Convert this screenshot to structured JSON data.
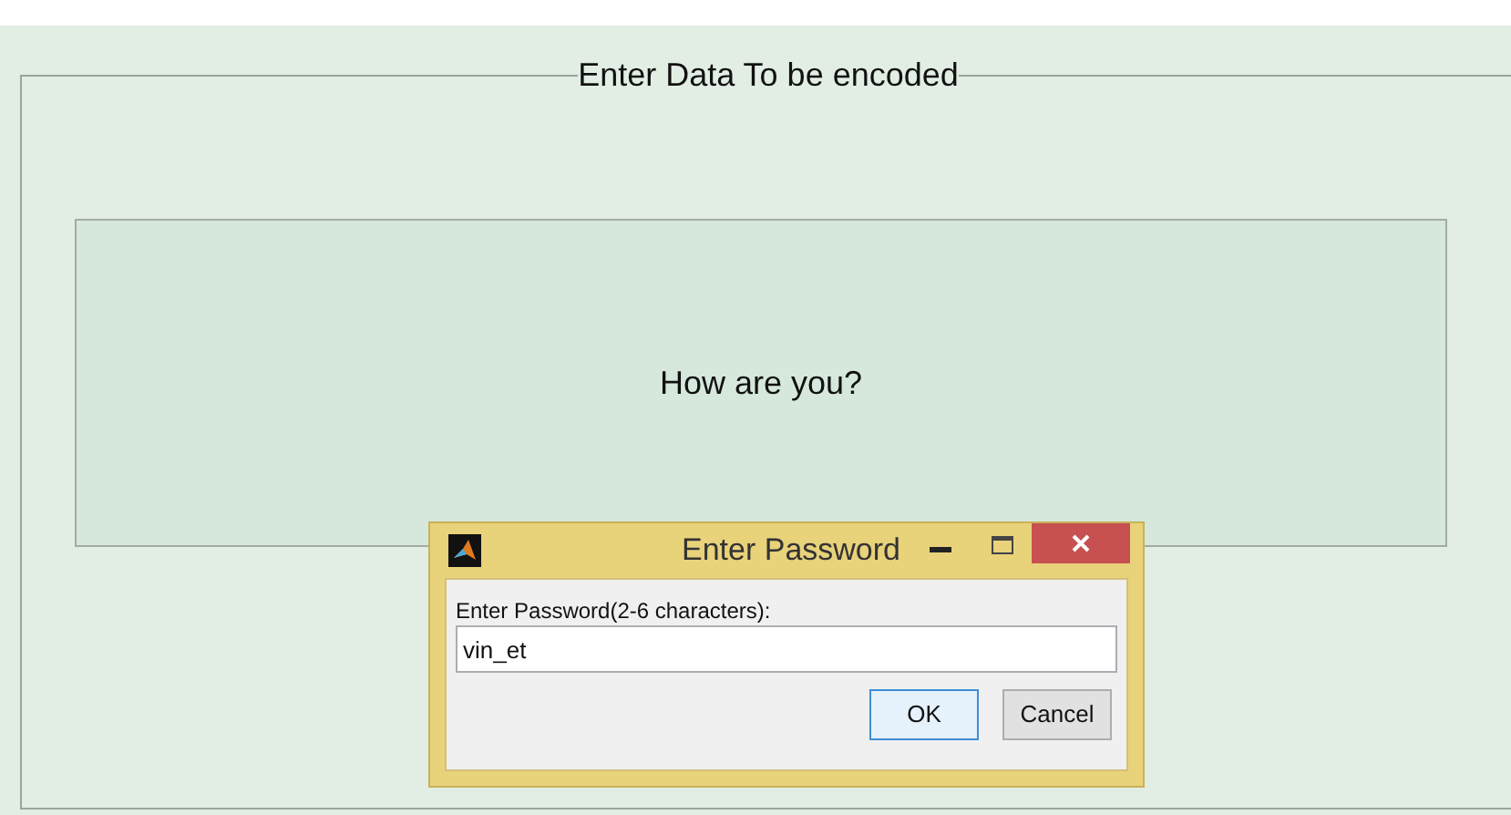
{
  "panel": {
    "title": "Enter Data To be encoded",
    "message": "How are you?"
  },
  "dialog": {
    "title": "Enter Password",
    "prompt": "Enter Password(2-6 characters):",
    "value": "vin_et",
    "buttons": [
      {
        "label": "OK",
        "kind": "default"
      },
      {
        "label": "Cancel",
        "kind": "normal"
      }
    ]
  }
}
